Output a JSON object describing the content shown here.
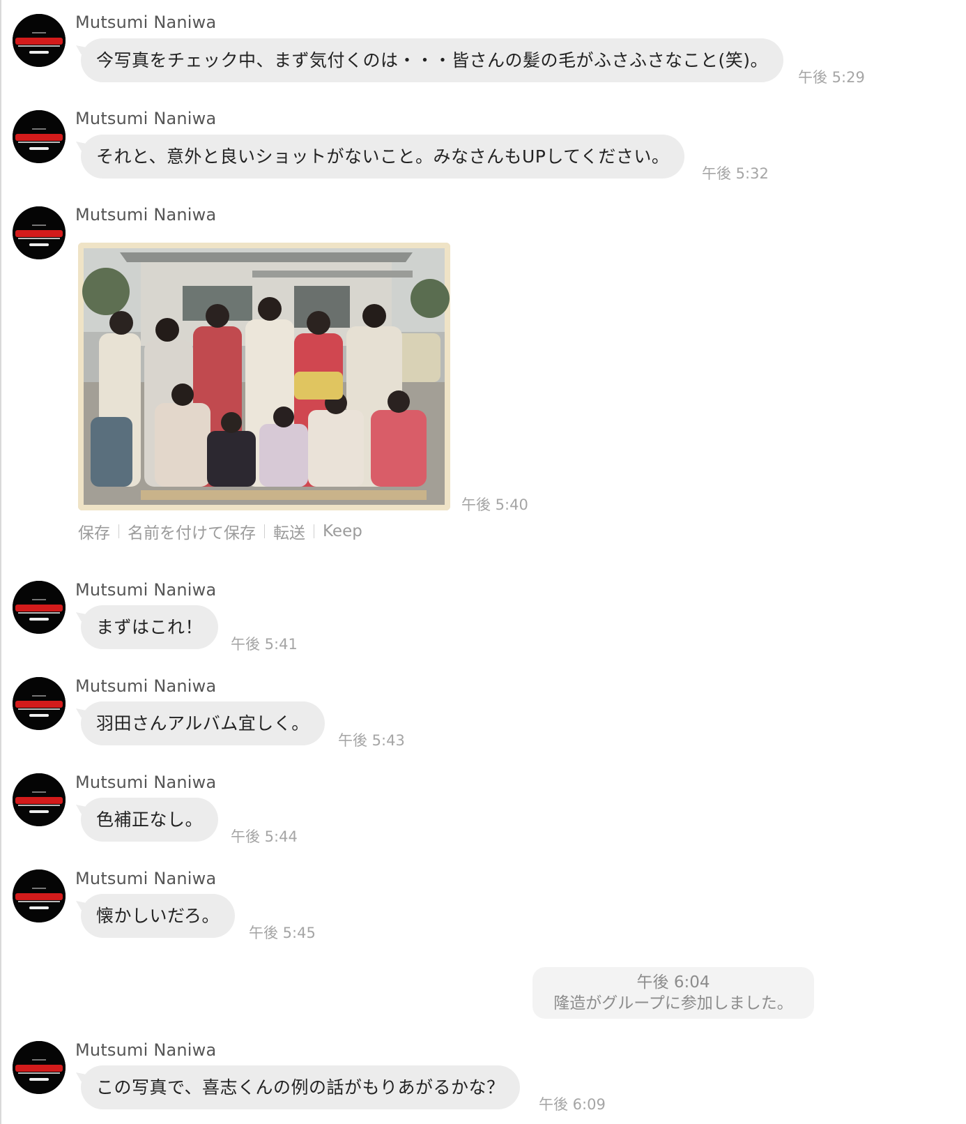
{
  "messages": [
    {
      "sender": "Mutsumi Naniwa",
      "text": "今写真をチェック中、まず気付くのは・・・皆さんの髪の毛がふさふさなこと(笑)。",
      "time": "午後 5:29"
    },
    {
      "sender": "Mutsumi Naniwa",
      "text": "それと、意外と良いショットがないこと。みなさんもUPしてください。",
      "time": "午後 5:32"
    },
    {
      "sender": "Mutsumi Naniwa",
      "image": "group-photo",
      "time": "午後 5:40",
      "image_actions": {
        "save": "保存",
        "save_as": "名前を付けて保存",
        "forward": "転送",
        "keep": "Keep"
      }
    },
    {
      "sender": "Mutsumi Naniwa",
      "text": "まずはこれ！",
      "time": "午後 5:41"
    },
    {
      "sender": "Mutsumi Naniwa",
      "text": "羽田さんアルバム宜しく。",
      "time": "午後 5:43"
    },
    {
      "sender": "Mutsumi Naniwa",
      "text": "色補正なし。",
      "time": "午後 5:44"
    },
    {
      "sender": "Mutsumi Naniwa",
      "text": "懐かしいだろ。",
      "time": "午後 5:45"
    },
    {
      "sender": "Mutsumi Naniwa",
      "text": "この写真で、喜志くんの例の話がもりあがるかな？",
      "time": "午後 6:09"
    }
  ],
  "system_notice": {
    "time": "午後 6:04",
    "text": "隆造がグループに参加しました。"
  },
  "colors": {
    "bubble": "#ececec",
    "time": "#a5a5a5",
    "sender": "#555555",
    "avatar_accent": "#d31b1b"
  }
}
